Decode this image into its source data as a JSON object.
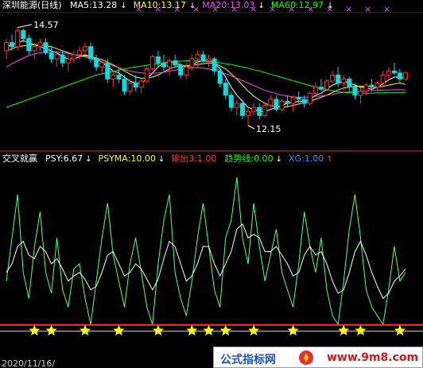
{
  "chart_data": [
    {
      "type": "line",
      "title": "深圳能源(日线)",
      "ma_labels": [
        {
          "name": "MA5",
          "value": "13.28",
          "color": "#ffffff"
        },
        {
          "name": "MA10",
          "value": "13.17",
          "color": "#ffff00"
        },
        {
          "name": "MA20",
          "value": "13.03",
          "color": "#ff40ff"
        },
        {
          "name": "MA60",
          "value": "12.97",
          "color": "#00ff00"
        }
      ],
      "annotations": [
        {
          "text": "14.57",
          "kind": "high"
        },
        {
          "text": "12.15",
          "kind": "low"
        }
      ],
      "ylim": [
        11.6,
        14.9
      ],
      "candles": [
        [
          14.0,
          14.3,
          13.8,
          14.2
        ],
        [
          14.2,
          14.4,
          14.0,
          14.1
        ],
        [
          14.1,
          14.57,
          14.0,
          14.5
        ],
        [
          14.5,
          14.55,
          14.2,
          14.3
        ],
        [
          14.3,
          14.4,
          13.9,
          14.0
        ],
        [
          14.0,
          14.2,
          13.8,
          14.1
        ],
        [
          14.1,
          14.3,
          14.0,
          14.2
        ],
        [
          14.2,
          14.3,
          13.9,
          13.95
        ],
        [
          13.95,
          14.1,
          13.7,
          13.8
        ],
        [
          13.8,
          14.0,
          13.6,
          13.9
        ],
        [
          13.9,
          14.0,
          13.6,
          13.7
        ],
        [
          13.7,
          13.9,
          13.5,
          13.8
        ],
        [
          13.8,
          14.0,
          13.7,
          13.9
        ],
        [
          13.9,
          14.1,
          13.8,
          14.0
        ],
        [
          14.0,
          14.2,
          13.9,
          14.1
        ],
        [
          14.1,
          14.2,
          13.7,
          13.8
        ],
        [
          13.8,
          13.9,
          13.5,
          13.6
        ],
        [
          13.6,
          13.8,
          13.4,
          13.7
        ],
        [
          13.7,
          13.8,
          13.2,
          13.3
        ],
        [
          13.3,
          13.5,
          13.1,
          13.4
        ],
        [
          13.4,
          13.6,
          13.2,
          13.3
        ],
        [
          13.3,
          13.4,
          12.9,
          13.0
        ],
        [
          13.0,
          13.3,
          12.9,
          13.2
        ],
        [
          13.2,
          13.4,
          13.0,
          13.1
        ],
        [
          13.1,
          13.3,
          12.95,
          13.25
        ],
        [
          13.25,
          13.6,
          13.2,
          13.55
        ],
        [
          13.55,
          13.9,
          13.5,
          13.85
        ],
        [
          13.85,
          14.0,
          13.6,
          13.7
        ],
        [
          13.7,
          13.9,
          13.5,
          13.6
        ],
        [
          13.6,
          13.8,
          13.4,
          13.75
        ],
        [
          13.75,
          13.9,
          13.6,
          13.65
        ],
        [
          13.65,
          13.7,
          13.3,
          13.4
        ],
        [
          13.4,
          13.7,
          13.3,
          13.6
        ],
        [
          13.6,
          13.9,
          13.5,
          13.8
        ],
        [
          13.8,
          14.0,
          13.6,
          13.9
        ],
        [
          13.9,
          14.0,
          13.7,
          13.75
        ],
        [
          13.75,
          13.9,
          13.6,
          13.8
        ],
        [
          13.8,
          13.85,
          13.4,
          13.5
        ],
        [
          13.5,
          13.6,
          13.1,
          13.2
        ],
        [
          13.2,
          13.3,
          12.8,
          12.9
        ],
        [
          12.9,
          13.0,
          12.5,
          12.6
        ],
        [
          12.6,
          12.8,
          12.4,
          12.7
        ],
        [
          12.7,
          12.8,
          12.3,
          12.4
        ],
        [
          12.4,
          12.6,
          12.15,
          12.5
        ],
        [
          12.5,
          12.7,
          12.4,
          12.6
        ],
        [
          12.6,
          12.7,
          12.3,
          12.4
        ],
        [
          12.4,
          12.7,
          12.35,
          12.65
        ],
        [
          12.65,
          12.9,
          12.6,
          12.8
        ],
        [
          12.8,
          12.9,
          12.5,
          12.55
        ],
        [
          12.55,
          12.8,
          12.5,
          12.75
        ],
        [
          12.75,
          12.9,
          12.6,
          12.7
        ],
        [
          12.7,
          12.9,
          12.5,
          12.85
        ],
        [
          12.85,
          13.0,
          12.7,
          12.8
        ],
        [
          12.8,
          12.9,
          12.6,
          12.7
        ],
        [
          12.7,
          13.0,
          12.65,
          12.95
        ],
        [
          12.95,
          13.2,
          12.9,
          13.1
        ],
        [
          13.1,
          13.3,
          13.0,
          13.05
        ],
        [
          13.05,
          13.3,
          13.0,
          13.25
        ],
        [
          13.25,
          13.5,
          13.2,
          13.4
        ],
        [
          13.4,
          13.6,
          13.1,
          13.2
        ],
        [
          13.2,
          13.4,
          13.0,
          13.3
        ],
        [
          13.3,
          13.35,
          13.0,
          13.1
        ],
        [
          13.1,
          13.2,
          12.8,
          12.9
        ],
        [
          12.9,
          13.1,
          12.7,
          13.0
        ],
        [
          13.0,
          13.2,
          12.9,
          13.15
        ],
        [
          13.15,
          13.3,
          13.0,
          13.1
        ],
        [
          13.1,
          13.25,
          13.0,
          13.2
        ],
        [
          13.2,
          13.5,
          13.1,
          13.4
        ],
        [
          13.4,
          13.6,
          13.3,
          13.5
        ],
        [
          13.5,
          13.7,
          13.4,
          13.45
        ],
        [
          13.45,
          13.55,
          13.2,
          13.3
        ],
        [
          13.3,
          13.5,
          13.25,
          13.45
        ]
      ],
      "ma_series": {
        "MA5": [
          14.1,
          14.15,
          14.2,
          14.25,
          14.2,
          14.15,
          14.1,
          14.05,
          14.0,
          13.95,
          13.85,
          13.8,
          13.8,
          13.85,
          13.9,
          13.85,
          13.8,
          13.72,
          13.6,
          13.5,
          13.45,
          13.35,
          13.25,
          13.2,
          13.2,
          13.3,
          13.45,
          13.6,
          13.7,
          13.72,
          13.7,
          13.65,
          13.6,
          13.65,
          13.72,
          13.75,
          13.78,
          13.7,
          13.55,
          13.35,
          13.1,
          12.9,
          12.75,
          12.6,
          12.55,
          12.5,
          12.5,
          12.55,
          12.6,
          12.65,
          12.7,
          12.72,
          12.75,
          12.75,
          12.8,
          12.9,
          12.95,
          13.05,
          13.15,
          13.2,
          13.25,
          13.2,
          13.15,
          13.1,
          13.08,
          13.05,
          13.1,
          13.18,
          13.28,
          13.35,
          13.35,
          13.32
        ],
        "MA10": [
          14.0,
          14.05,
          14.1,
          14.12,
          14.14,
          14.15,
          14.15,
          14.12,
          14.1,
          14.05,
          14.0,
          13.95,
          13.9,
          13.88,
          13.87,
          13.85,
          13.82,
          13.78,
          13.72,
          13.65,
          13.58,
          13.5,
          13.42,
          13.35,
          13.32,
          13.32,
          13.35,
          13.4,
          13.48,
          13.55,
          13.6,
          13.63,
          13.63,
          13.64,
          13.66,
          13.68,
          13.7,
          13.68,
          13.63,
          13.55,
          13.43,
          13.3,
          13.15,
          13.0,
          12.88,
          12.78,
          12.7,
          12.65,
          12.62,
          12.6,
          12.62,
          12.65,
          12.68,
          12.72,
          12.75,
          12.8,
          12.85,
          12.9,
          12.97,
          13.03,
          13.08,
          13.1,
          13.12,
          13.12,
          13.12,
          13.1,
          13.1,
          13.12,
          13.15,
          13.18,
          13.2,
          13.17
        ],
        "MA20": [
          13.6,
          13.68,
          13.75,
          13.82,
          13.88,
          13.92,
          13.95,
          13.97,
          13.98,
          13.97,
          13.95,
          13.93,
          13.9,
          13.87,
          13.84,
          13.8,
          13.77,
          13.72,
          13.68,
          13.63,
          13.58,
          13.53,
          13.5,
          13.47,
          13.45,
          13.44,
          13.44,
          13.45,
          13.47,
          13.5,
          13.52,
          13.55,
          13.57,
          13.58,
          13.58,
          13.57,
          13.55,
          13.52,
          13.48,
          13.43,
          13.38,
          13.32,
          13.26,
          13.2,
          13.14,
          13.08,
          13.02,
          12.98,
          12.94,
          12.9,
          12.88,
          12.86,
          12.85,
          12.85,
          12.86,
          12.87,
          12.88,
          12.9,
          12.92,
          12.95,
          12.97,
          12.98,
          12.99,
          13.0,
          13.01,
          13.02,
          13.02,
          13.03,
          13.03,
          13.04,
          13.04,
          13.03
        ],
        "MA60": [
          12.6,
          12.65,
          12.7,
          12.75,
          12.8,
          12.85,
          12.9,
          12.95,
          13.0,
          13.05,
          13.1,
          13.15,
          13.2,
          13.25,
          13.3,
          13.35,
          13.4,
          13.43,
          13.46,
          13.49,
          13.52,
          13.55,
          13.58,
          13.6,
          13.62,
          13.64,
          13.66,
          13.68,
          13.7,
          13.72,
          13.73,
          13.74,
          13.75,
          13.75,
          13.75,
          13.74,
          13.73,
          13.72,
          13.7,
          13.68,
          13.66,
          13.63,
          13.6,
          13.57,
          13.53,
          13.5,
          13.46,
          13.42,
          13.38,
          13.34,
          13.3,
          13.26,
          13.22,
          13.18,
          13.14,
          13.1,
          13.07,
          13.04,
          13.01,
          12.99,
          12.97,
          12.96,
          12.95,
          12.95,
          12.95,
          12.95,
          12.96,
          12.96,
          12.97,
          12.97,
          12.97,
          12.97
        ]
      }
    },
    {
      "type": "line",
      "indicator_labels": [
        {
          "text": "交叉就赢",
          "color": "#ffffff"
        },
        {
          "text": "PSY:6.67",
          "color": "#ffffff",
          "arrow": "↓",
          "arrow_color": "#ffffff"
        },
        {
          "text": "PSYMA:10.00",
          "color": "#ffff00",
          "arrow": "↓",
          "arrow_color": "#ffffff"
        },
        {
          "text": "输出3:1.00",
          "color": "#ff3030",
          "arrow": "",
          "arrow_color": "#ffffff"
        },
        {
          "text": "趋势线:0.00",
          "color": "#00ff00",
          "arrow": "↓",
          "arrow_color": "#ffffff"
        },
        {
          "text": "XG:1.00",
          "color": "#4080ff",
          "arrow": "↑",
          "arrow_color": "#ff3030"
        }
      ],
      "ylim": [
        0,
        100
      ],
      "series": [
        {
          "name": "PSY",
          "color": "#55ff88",
          "values": [
            35,
            60,
            85,
            40,
            25,
            55,
            75,
            40,
            28,
            60,
            30,
            20,
            42,
            45,
            25,
            10,
            35,
            60,
            80,
            50,
            35,
            20,
            45,
            60,
            40,
            20,
            10,
            45,
            70,
            85,
            40,
            25,
            15,
            35,
            60,
            80,
            55,
            30,
            20,
            60,
            70,
            95,
            60,
            45,
            80,
            55,
            35,
            50,
            65,
            40,
            30,
            20,
            45,
            75,
            55,
            40,
            60,
            30,
            15,
            10,
            35,
            65,
            85,
            60,
            30,
            20,
            15,
            10,
            30,
            55,
            35,
            40
          ]
        },
        {
          "name": "PSYMA",
          "color": "#ffffff",
          "values": [
            40,
            45,
            55,
            58,
            50,
            48,
            55,
            52,
            45,
            48,
            42,
            35,
            38,
            40,
            36,
            30,
            32,
            40,
            50,
            52,
            45,
            38,
            40,
            45,
            42,
            36,
            30,
            36,
            48,
            58,
            55,
            45,
            35,
            38,
            45,
            55,
            55,
            45,
            38,
            45,
            52,
            65,
            68,
            60,
            62,
            60,
            52,
            52,
            55,
            50,
            45,
            38,
            40,
            50,
            55,
            50,
            52,
            45,
            35,
            28,
            30,
            40,
            52,
            58,
            50,
            40,
            32,
            25,
            28,
            35,
            38,
            42
          ]
        }
      ],
      "markers": [
        {
          "name": "输出3",
          "value": 5,
          "indices": [
            5,
            8,
            14,
            20,
            27,
            33,
            36,
            39,
            44,
            51,
            60,
            63,
            70
          ]
        }
      ],
      "baseline_value": 7,
      "date_label": "2020/11/16/",
      "watermark": {
        "left": "公式指标网",
        "right": "www.9m8.com"
      }
    }
  ]
}
